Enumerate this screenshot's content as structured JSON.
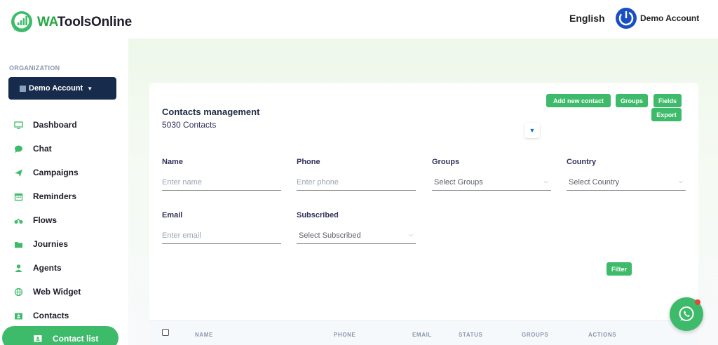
{
  "brand": {
    "prefix": "WA",
    "rest": "ToolsOnline"
  },
  "header": {
    "language": "English",
    "account": "Demo Account"
  },
  "sidebar": {
    "org_label": "ORGANIZATION",
    "org_button": "Demo Account",
    "items": [
      {
        "label": "Dashboard",
        "icon": "monitor-icon"
      },
      {
        "label": "Chat",
        "icon": "chat-bubble-icon"
      },
      {
        "label": "Campaigns",
        "icon": "paper-plane-icon"
      },
      {
        "label": "Reminders",
        "icon": "calendar-icon"
      },
      {
        "label": "Flows",
        "icon": "bicycle-icon"
      },
      {
        "label": "Journies",
        "icon": "folder-icon"
      },
      {
        "label": "Agents",
        "icon": "person-icon"
      },
      {
        "label": "Web Widget",
        "icon": "globe-icon"
      },
      {
        "label": "Contacts",
        "icon": "contacts-icon"
      }
    ],
    "active_item": {
      "label": "Contact list",
      "icon": "contact-card-icon"
    }
  },
  "card": {
    "title": "Contacts management",
    "subtitle": "5030 Contacts",
    "buttons": {
      "add": "Add new contact",
      "groups": "Groups",
      "fields": "Fields",
      "export": "Export"
    }
  },
  "filters": {
    "name": {
      "label": "Name",
      "placeholder": "Enter name"
    },
    "phone": {
      "label": "Phone",
      "placeholder": "Enter phone"
    },
    "groups": {
      "label": "Groups",
      "value": "Select Groups"
    },
    "country": {
      "label": "Country",
      "value": "Select Country"
    },
    "email": {
      "label": "Email",
      "placeholder": "Enter email"
    },
    "subscribed": {
      "label": "Subscribed",
      "value": "Select Subscribed"
    },
    "filter_button": "Filter"
  },
  "table": {
    "columns": [
      "NAME",
      "PHONE",
      "EMAIL",
      "STATUS",
      "GROUPS",
      "ACTIONS"
    ]
  },
  "colors": {
    "accent": "#3dbb6a",
    "dark": "#172b4d",
    "power": "#1a4fc4"
  }
}
